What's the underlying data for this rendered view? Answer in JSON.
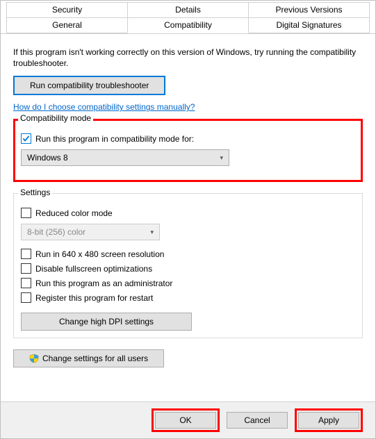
{
  "tabs": {
    "row1": [
      "Security",
      "Details",
      "Previous Versions"
    ],
    "row2": [
      "General",
      "Compatibility",
      "Digital Signatures"
    ],
    "active": "Compatibility"
  },
  "intro": "If this program isn't working correctly on this version of Windows, try running the compatibility troubleshooter.",
  "troubleshooter_btn": "Run compatibility troubleshooter",
  "help_link": "How do I choose compatibility settings manually?",
  "compat_group": {
    "legend": "Compatibility mode",
    "checkbox_label": "Run this program in compatibility mode for:",
    "checkbox_checked": true,
    "combo_value": "Windows 8"
  },
  "settings_group": {
    "legend": "Settings",
    "reduced_color": "Reduced color mode",
    "color_combo": "8-bit (256) color",
    "run640": "Run in 640 x 480 screen resolution",
    "disable_fs": "Disable fullscreen optimizations",
    "run_admin": "Run this program as an administrator",
    "register_restart": "Register this program for restart",
    "dpi_btn": "Change high DPI settings"
  },
  "all_users_btn": "Change settings for all users",
  "footer": {
    "ok": "OK",
    "cancel": "Cancel",
    "apply": "Apply"
  }
}
